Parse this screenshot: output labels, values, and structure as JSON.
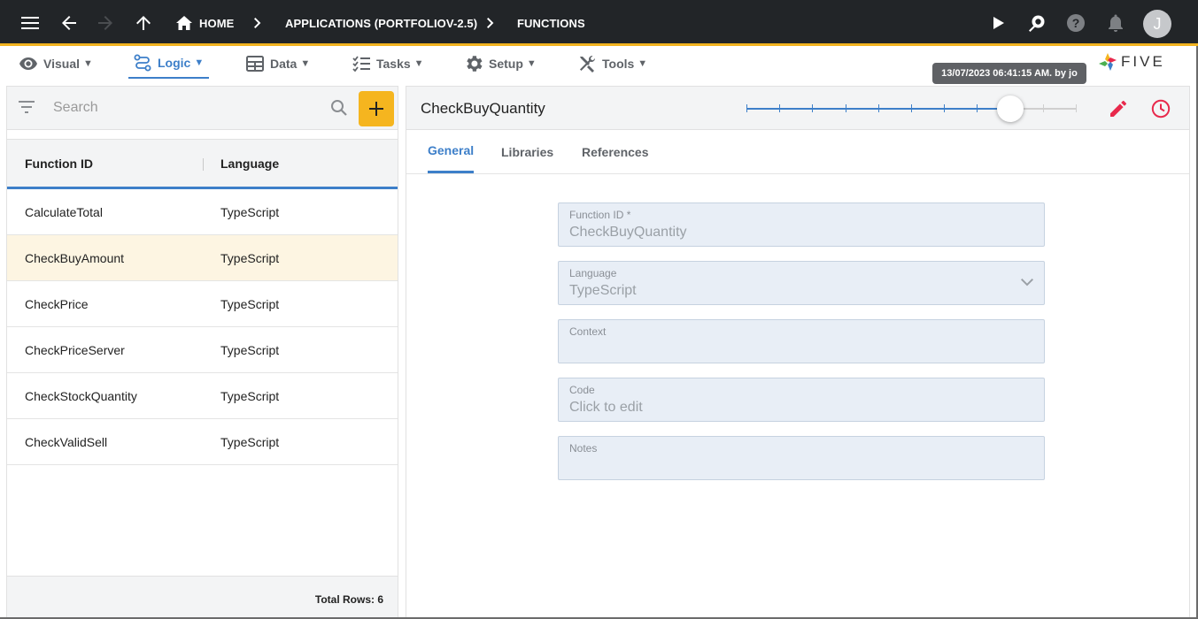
{
  "topbar": {
    "breadcrumbs": [
      {
        "label": "HOME"
      },
      {
        "label": "APPLICATIONS (PORTFOLIOV-2.5)"
      },
      {
        "label": "FUNCTIONS"
      }
    ],
    "avatar_initial": "J"
  },
  "menu": {
    "items": [
      {
        "label": "Visual",
        "icon": "eye-icon"
      },
      {
        "label": "Logic",
        "icon": "logic-flow-icon",
        "active": true
      },
      {
        "label": "Data",
        "icon": "table-grid-icon"
      },
      {
        "label": "Tasks",
        "icon": "checklist-icon"
      },
      {
        "label": "Setup",
        "icon": "gear-icon"
      },
      {
        "label": "Tools",
        "icon": "wrench-screwdriver-icon"
      }
    ],
    "caret": "▼"
  },
  "tooltip": "13/07/2023 06:41:15 AM. by jo",
  "logo": {
    "text": "FIVE"
  },
  "list": {
    "search_placeholder": "Search",
    "columns": [
      "Function ID",
      "Language"
    ],
    "rows": [
      {
        "id": "CalculateTotal",
        "language": "TypeScript"
      },
      {
        "id": "CheckBuyAmount",
        "language": "TypeScript",
        "selected": true
      },
      {
        "id": "CheckPrice",
        "language": "TypeScript"
      },
      {
        "id": "CheckPriceServer",
        "language": "TypeScript"
      },
      {
        "id": "CheckStockQuantity",
        "language": "TypeScript"
      },
      {
        "id": "CheckValidSell",
        "language": "TypeScript"
      }
    ],
    "footer": "Total Rows: 6"
  },
  "detail": {
    "title": "CheckBuyQuantity",
    "history_slider": {
      "steps": 11,
      "position": 8
    },
    "tabs": [
      {
        "label": "General",
        "active": true
      },
      {
        "label": "Libraries"
      },
      {
        "label": "References"
      }
    ],
    "fields": [
      {
        "label": "Function ID *",
        "value": "CheckBuyQuantity"
      },
      {
        "label": "Language",
        "value": "TypeScript",
        "dropdown": true
      },
      {
        "label": "Context",
        "value": ""
      },
      {
        "label": "Code",
        "value": "Click to edit"
      },
      {
        "label": "Notes",
        "value": ""
      }
    ]
  },
  "colors": {
    "topbar_bg": "#222528",
    "accent_yellow": "#f5b51f",
    "accent_blue": "#3d7fc9",
    "action_red": "#e8294c",
    "selected_row": "#fdf5e2"
  }
}
